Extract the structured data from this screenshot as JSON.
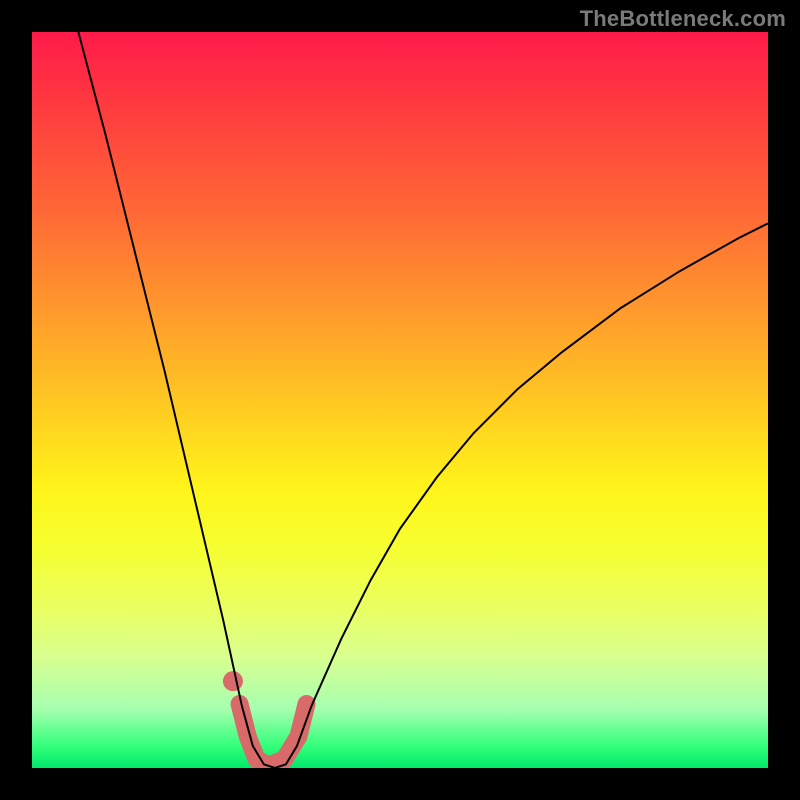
{
  "watermark": "TheBottleneck.com",
  "chart_data": {
    "type": "line",
    "title": "",
    "xlabel": "",
    "ylabel": "",
    "xlim": [
      0,
      1
    ],
    "ylim": [
      0,
      1
    ],
    "background_gradient_bottom_to_top": [
      "#00e86a",
      "#33ff7a",
      "#a6ffb0",
      "#d8ff90",
      "#eaff60",
      "#f6ff30",
      "#fff41a",
      "#ffc722",
      "#ff9a2c",
      "#ff6a35",
      "#ff3a3f",
      "#ff1a4a"
    ],
    "series": [
      {
        "name": "bottleneck-curve",
        "stroke": "#000000",
        "stroke_width": 2,
        "x": [
          0.063,
          0.1,
          0.14,
          0.18,
          0.22,
          0.26,
          0.285,
          0.3,
          0.315,
          0.33,
          0.345,
          0.36,
          0.38,
          0.42,
          0.46,
          0.5,
          0.55,
          0.6,
          0.66,
          0.72,
          0.8,
          0.88,
          0.96,
          1.0
        ],
        "y": [
          1.0,
          0.86,
          0.7,
          0.54,
          0.37,
          0.2,
          0.085,
          0.03,
          0.005,
          0.0,
          0.005,
          0.03,
          0.085,
          0.175,
          0.255,
          0.325,
          0.395,
          0.455,
          0.515,
          0.565,
          0.625,
          0.675,
          0.72,
          0.74
        ]
      },
      {
        "name": "valley-highlight",
        "stroke": "#d86a6a",
        "stroke_width": 18,
        "linecap": "round",
        "x": [
          0.282,
          0.293,
          0.305,
          0.322,
          0.343,
          0.362,
          0.373
        ],
        "y": [
          0.087,
          0.043,
          0.012,
          0.003,
          0.012,
          0.043,
          0.087
        ]
      },
      {
        "name": "valley-dot",
        "type": "scatter",
        "fill": "#d86a6a",
        "radius": 10,
        "x": [
          0.273
        ],
        "y": [
          0.118
        ]
      }
    ]
  }
}
